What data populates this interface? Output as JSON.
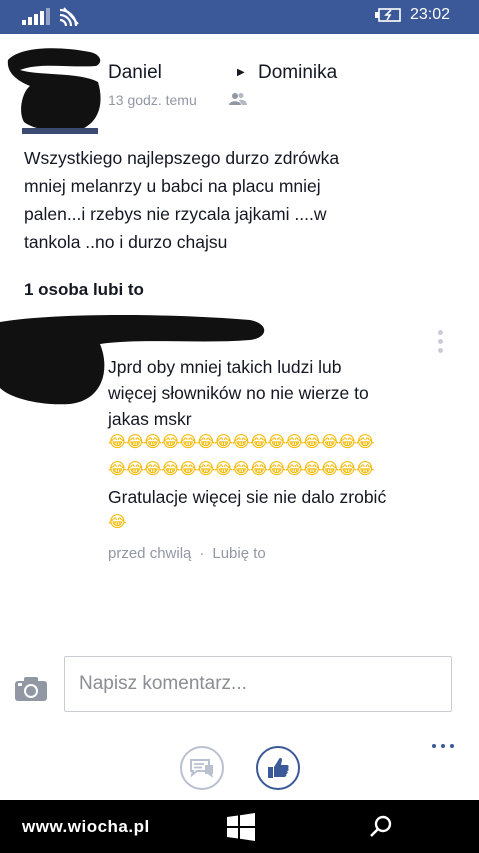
{
  "status_bar": {
    "time": "23:02",
    "background": "#3b5998"
  },
  "post": {
    "author": "Daniel",
    "target": "Dominika",
    "time": "13 godz. temu",
    "text": "Wszystkiego najlepszego durzo zdrówka\nmniej melanrzy u babci na placu mniej\npalen...i rzebys nie rzycala jajkami  ....w\ntankola ..no i durzo chajsu",
    "likes": "1 osoba lubi to"
  },
  "comment": {
    "text": "Jprd oby mniej takich ludzi lub\nwięcej słowników no nie wierze to\njakas mskr",
    "emoji_row_1": "😂😂😂😂😂😂😂😂😂😂😂😂😂😂😂",
    "emoji_row_2": "😂😂😂😂😂😂😂😂😂😂😂😂😂😂😂",
    "text_2": "Gratulacje więcej sie nie dalo zrobić",
    "emoji_single": "😂",
    "time": "przed chwilą",
    "separator": "·",
    "like_link": "Lubię to"
  },
  "composer": {
    "placeholder": "Napisz komentarz..."
  },
  "icons": {
    "signal": "signal-icon",
    "wifi": "wifi-icon",
    "battery": "battery-charging-icon",
    "friends": "friends-icon",
    "more": "more-vertical-icon",
    "camera": "camera-icon",
    "comments": "comments-icon",
    "like": "thumbs-up-icon",
    "windows": "windows-icon",
    "search": "search-icon"
  },
  "nav_bar": {
    "watermark": "www.wiocha.pl"
  }
}
